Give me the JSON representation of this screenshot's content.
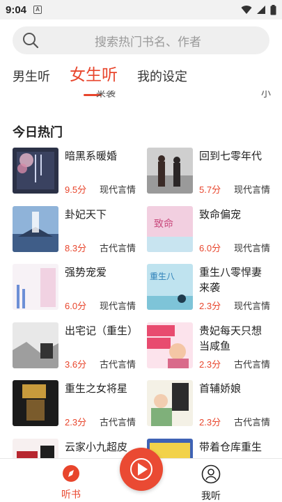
{
  "status": {
    "time": "9:04"
  },
  "search": {
    "placeholder": "搜索热门书名、作者"
  },
  "tabs": [
    {
      "label": "男生听",
      "active": false
    },
    {
      "label": "女生听",
      "active": true
    },
    {
      "label": "我的设定",
      "active": false
    }
  ],
  "peek": {
    "left": "来袭",
    "right": "小"
  },
  "section": {
    "title": "今日热门"
  },
  "books": [
    {
      "title": "暗黑系暖婚",
      "score": "9.5分",
      "genre": "现代言情"
    },
    {
      "title": "回到七零年代",
      "score": "5.7分",
      "genre": "现代言情"
    },
    {
      "title": "卦妃天下",
      "score": "8.3分",
      "genre": "古代言情"
    },
    {
      "title": "致命偏宠",
      "score": "6.0分",
      "genre": "现代言情"
    },
    {
      "title": "强势宠爱",
      "score": "6.0分",
      "genre": "现代言情"
    },
    {
      "title": "重生八零悍妻来袭",
      "score": "2.3分",
      "genre": "现代言情"
    },
    {
      "title": "出宅记（重生）",
      "score": "3.6分",
      "genre": "古代言情"
    },
    {
      "title": "贵妃每天只想当咸鱼",
      "score": "2.3分",
      "genre": "古代言情"
    },
    {
      "title": "重生之女将星",
      "score": "2.3分",
      "genre": "古代言情"
    },
    {
      "title": "首辅娇娘",
      "score": "2.3分",
      "genre": "古代言情"
    },
    {
      "title": "云家小九超皮",
      "score": "",
      "genre": ""
    },
    {
      "title": "带着仓库重生",
      "score": "",
      "genre": ""
    }
  ],
  "bottom_nav": {
    "books_label": "听书",
    "me_label": "我听"
  },
  "colors": {
    "accent": "#e8452c",
    "background": "#ffffff",
    "search_bg": "#efefef"
  }
}
